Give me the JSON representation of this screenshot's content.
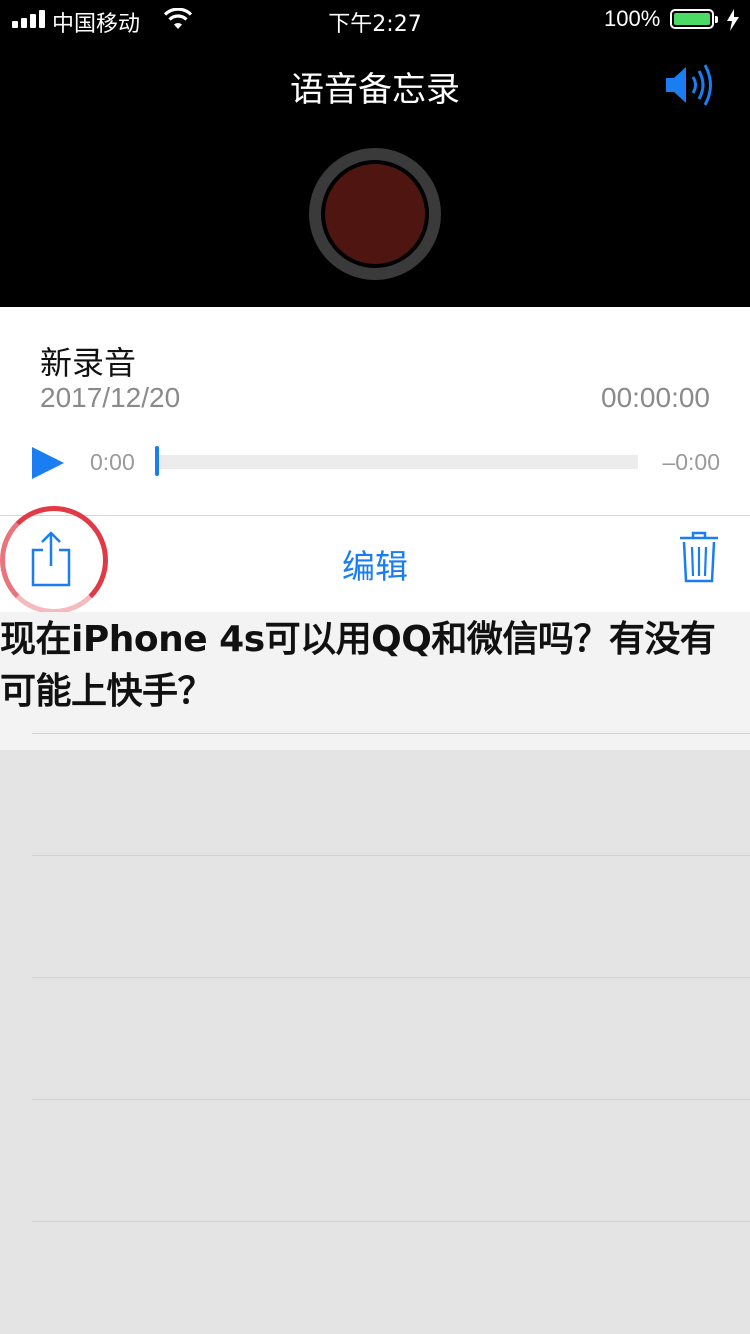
{
  "status_bar": {
    "carrier": "中国移动",
    "time": "下午2:27",
    "battery": "100%"
  },
  "header": {
    "title": "语音备忘录"
  },
  "recording": {
    "name": "新录音",
    "date": "2017/12/20",
    "duration": "00:00:00",
    "elapsed": "0:00",
    "remaining": "–0:00",
    "progress": 0
  },
  "toolbar": {
    "edit_label": "编辑"
  },
  "caption": {
    "text": "现在iPhone 4s可以用QQ和微信吗？有没有可能上快手？"
  },
  "colors": {
    "accent": "#1a7ef2",
    "record_button": "#4f1511",
    "highlight_circle": "#e23a45"
  },
  "icons": [
    "cellular-signal-icon",
    "wifi-icon",
    "battery-icon",
    "charging-bolt-icon",
    "speaker-icon",
    "record-button",
    "play-icon",
    "share-icon",
    "trash-icon"
  ]
}
